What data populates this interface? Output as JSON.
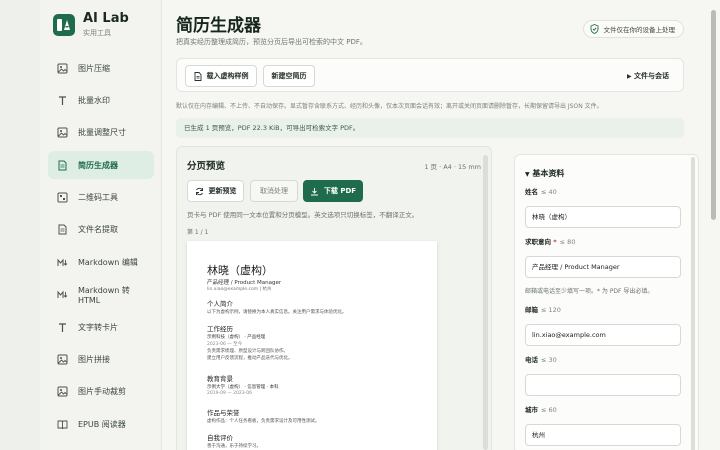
{
  "brand": {
    "title": "AI Lab",
    "subtitle": "实用工具"
  },
  "sidebar": {
    "items": [
      {
        "label": "图片压缩",
        "icon": "image-icon",
        "active": false
      },
      {
        "label": "批量水印",
        "icon": "text-t-icon",
        "active": false
      },
      {
        "label": "批量调整尺寸",
        "icon": "image-icon",
        "active": false
      },
      {
        "label": "简历生成器",
        "icon": "document-icon",
        "active": true
      },
      {
        "label": "二维码工具",
        "icon": "qr-icon",
        "active": false
      },
      {
        "label": "文件名提取",
        "icon": "document-icon",
        "active": false
      },
      {
        "label": "Markdown 编辑",
        "icon": "markdown-icon",
        "active": false
      },
      {
        "label": "Markdown 转 HTML",
        "icon": "markdown-icon",
        "active": false
      },
      {
        "label": "文字转卡片",
        "icon": "text-t-icon",
        "active": false
      },
      {
        "label": "图片拼接",
        "icon": "image-icon",
        "active": false
      },
      {
        "label": "图片手动裁剪",
        "icon": "image-icon",
        "active": false
      },
      {
        "label": "EPUB 阅读器",
        "icon": "book-icon",
        "active": false
      }
    ]
  },
  "header": {
    "title": "简历生成器",
    "subtitle": "把真实经历整理成简历，预览分页后导出可检索的中文 PDF。",
    "privacy_badge": "文件仅在你的设备上处理"
  },
  "toolbar": {
    "load_sample": "载入虚构样例",
    "new_blank": "新建空简历",
    "file_menu": "文件与会话"
  },
  "notice": "默认仅在内存编辑、不上传、不自动保存。显式暂存含联系方式、经历和头像，仅本次页面会话有效；离开或关闭页面请删除暂存，长期保留请导出 JSON 文件。",
  "status": "已生成 1 页预览，PDF 22.3 KiB，可导出可检索文字 PDF。",
  "preview": {
    "title": "分页预览",
    "meta": "1 页 · A4 · 15 mm",
    "refresh": "更新预览",
    "cancel": "取消处理",
    "download": "下载 PDF",
    "desc": "页卡与 PDF 使用同一文本位置和分页模型。英文选项只切换标签，不翻译正文。",
    "page_label": "第 1 / 1"
  },
  "resume": {
    "name": "林晓（虚构）",
    "role": "产品经理 / Product Manager",
    "contact": "lin.xiao@example.com | 杭州",
    "s1_title": "个人简介",
    "s1_text": "以下为虚构示例，请替换为本人真实信息。关注用户需求与体验优化。",
    "s2_title": "工作经历",
    "s2_org": "示例科技（虚构） · 产品经理",
    "s2_date": "2023-06 — 至今",
    "s2_line1": "负责需求梳理、原型设计与跨团队协作。",
    "s2_line2": "建立用户反馈流程，推动产品迭代与优化。",
    "s3_title": "教育背景",
    "s3_org": "示例大学（虚构） · 信息管理 · 本科",
    "s3_date": "2019-09 — 2023-06",
    "s4_title": "作品与荣誉",
    "s4_text": "虚构作品：个人任务看板，负责需求设计及可用性测试。",
    "s5_title": "自我评价",
    "s5_text": "善于沟通，乐于持续学习。"
  },
  "form": {
    "section": "基本资料",
    "name_label": "姓名",
    "name_limit": "≤ 40",
    "name_value": "林晓（虚构）",
    "role_label": "求职意向",
    "role_limit": "≤ 80",
    "role_value": "产品经理 / Product Manager",
    "hint": "邮箱或电话至少填写一项。* 为 PDF 导出必填。",
    "email_label": "邮箱",
    "email_limit": "≤ 120",
    "email_value": "lin.xiao@example.com",
    "phone_label": "电话",
    "phone_limit": "≤ 30",
    "phone_value": "",
    "city_label": "城市",
    "city_limit": "≤ 60",
    "city_value": "杭州"
  }
}
